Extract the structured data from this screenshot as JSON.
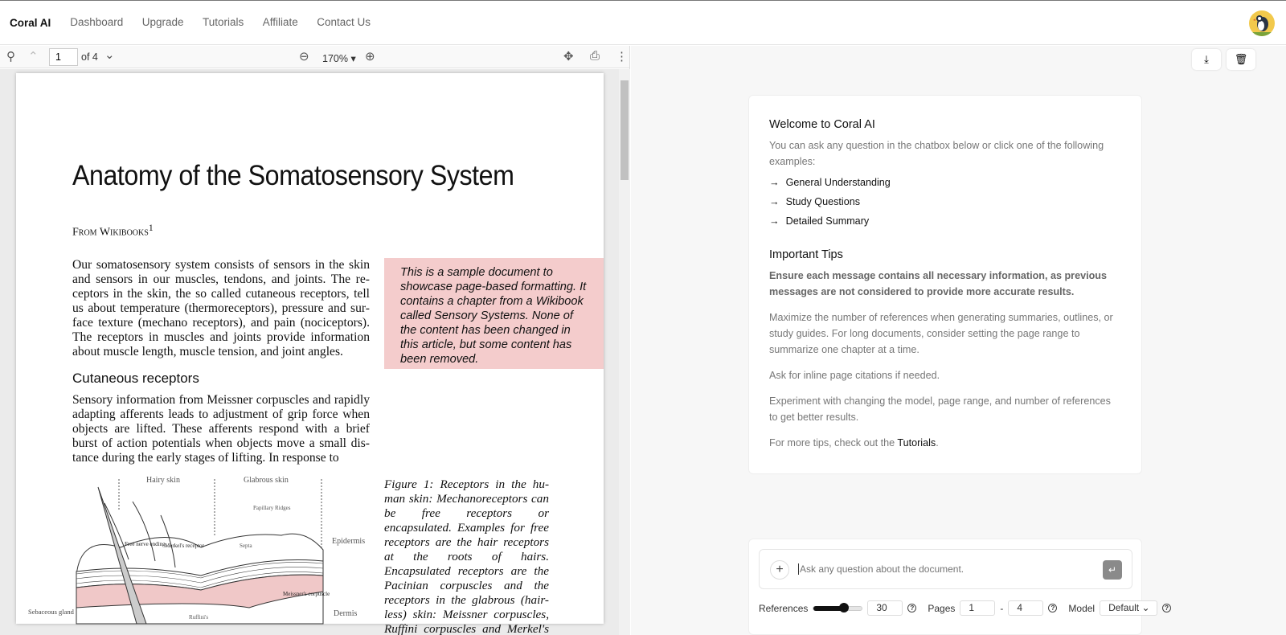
{
  "header": {
    "brand": "Coral AI",
    "nav": [
      "Dashboard",
      "Upgrade",
      "Tutorials",
      "Affiliate",
      "Contact Us"
    ]
  },
  "toolbar": {
    "page": "1",
    "of": "of 4",
    "zoom": "170%"
  },
  "document": {
    "title": "Anatomy of the Somatosensory System",
    "from": "From Wikibooks",
    "from_sup": "1",
    "intro": "Our somatosensory system consists of sensors in the skin and sensors in our muscles, tendons, and joints. The re-ceptors in the skin, the so called cutaneous receptors, tell us about temperature (thermoreceptors), pressure and sur-face texture (mechano receptors), and pain (nociceptors). The receptors in muscles and joints provide information about muscle length, muscle tension, and joint angles.",
    "note": "This is a sample document to showcase page-based formatting. It contains a chapter from a Wikibook called Sensory Systems. None of the content has been changed in this article, but some content has been removed.",
    "section": "Cutaneous receptors",
    "section_text": "Sensory information from Meissner corpuscles and rapidly adapting afferents leads to adjustment of grip force when objects are lifted. These afferents respond with a brief burst of action potentials when objects move a small dis-tance during the early stages of lifting. In response to",
    "caption": "Figure 1: Receptors in the hu-man skin: Mechanoreceptors can be free receptors or encapsulated. Examples for free receptors are the hair receptors at the roots of hairs. Encapsulated receptors are the Pacinian corpuscles and the receptors in the glabrous (hair-less) skin: Meissner corpuscles, Ruffini corpuscles and Merkel's disks.",
    "figure_labels": {
      "hairy": "Hairy skin",
      "glabrous": "Glabrous skin",
      "ridges": "Papillary Ridges",
      "free": "Free nerve ending",
      "merkel": "Merkel's receptor",
      "septa": "Septa",
      "epidermis": "Epidermis",
      "dermis": "Dermis",
      "sebaceous": "Sebaceous gland",
      "meissner": "Meissner's corpuscle",
      "ruffini": "Ruffini's"
    }
  },
  "welcome": {
    "title": "Welcome to Coral AI",
    "intro": "You can ask any question in the chatbox below or click one of the following examples:",
    "examples": [
      "General Understanding",
      "Study Questions",
      "Detailed Summary"
    ],
    "tips_title": "Important Tips",
    "tip1": "Ensure each message contains all necessary information, as previous messages are not considered to provide more accurate results.",
    "tip2": "Maximize the number of references when generating summaries, outlines, or study guides. For long documents, consider setting the page range to summarize one chapter at a time.",
    "tip3": "Ask for inline page citations if needed.",
    "tip4": "Experiment with changing the model, page range, and number of references to get better results.",
    "tip5_pre": "For more tips, check out the ",
    "tip5_link": "Tutorials",
    "tip5_post": "."
  },
  "chat": {
    "placeholder": "Ask any question about the document.",
    "references_label": "References",
    "references": "30",
    "references_fraction": 0.62,
    "pages_label": "Pages",
    "page_from": "1",
    "page_to": "4",
    "dash": "-",
    "model_label": "Model",
    "model": "Default"
  },
  "colors": {
    "note_bg": "#f4cccc",
    "accent": "#111111"
  }
}
